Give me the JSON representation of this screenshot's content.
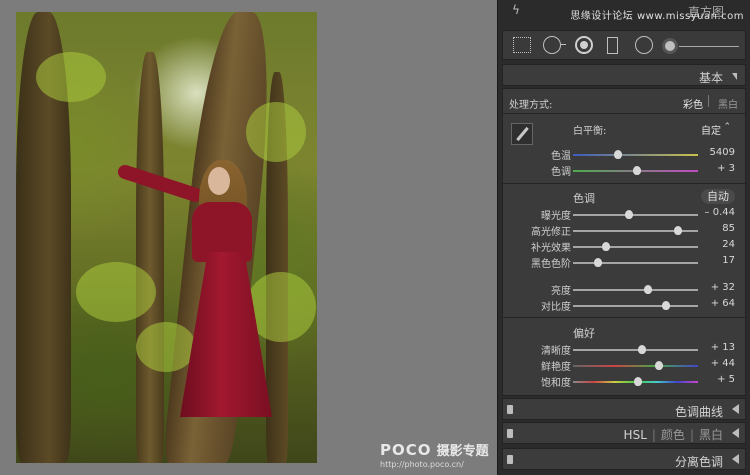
{
  "watermark": {
    "logo": "POCO",
    "brand": "摄影专题",
    "url": "http://photo.poco.cn/"
  },
  "panel": {
    "histogram_title": "直方图",
    "forum": "思缘设计论坛 www.missyuan.com",
    "basic_title": "基本",
    "treatment_label": "处理方式:",
    "treatment_color": "彩色",
    "treatment_bw": "黑白",
    "wb_label": "白平衡:",
    "wb_value": "自定",
    "temp_label": "色温",
    "temp_value": "5409",
    "tint_label": "色调",
    "tint_value": "+ 3",
    "tone_header": "色调",
    "auto_label": "自动",
    "exposure_label": "曝光度",
    "exposure_value": "– 0.44",
    "highlights_label": "高光修正",
    "highlights_value": "85",
    "fill_label": "补光效果",
    "fill_value": "24",
    "blacks_label": "黑色色阶",
    "blacks_value": "17",
    "brightness_label": "亮度",
    "brightness_value": "+ 32",
    "contrast_label": "对比度",
    "contrast_value": "+ 64",
    "presence_header": "偏好",
    "clarity_label": "清晰度",
    "clarity_value": "+ 13",
    "vibrance_label": "鲜艳度",
    "vibrance_value": "+ 44",
    "saturation_label": "饱和度",
    "saturation_value": "+ 5",
    "tone_curve_title": "色调曲线",
    "hsl_label": "HSL",
    "hsl_color": "颜色",
    "hsl_bw": "黑白",
    "split_title": "分离色调"
  },
  "sliders": {
    "temp": 0.36,
    "tint": 0.51,
    "exposure": 0.45,
    "highlights": 0.84,
    "fill": 0.26,
    "blacks": 0.2,
    "brightness": 0.6,
    "contrast": 0.74,
    "clarity": 0.55,
    "vibrance": 0.69,
    "saturation": 0.52
  }
}
